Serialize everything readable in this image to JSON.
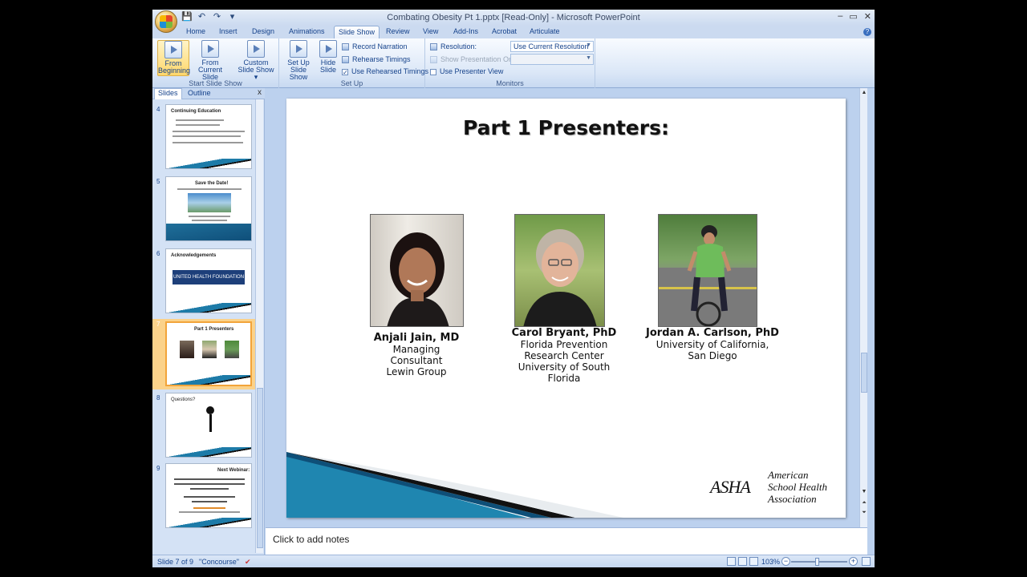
{
  "window": {
    "title": "Combating Obesity Pt 1.pptx [Read-Only] - Microsoft PowerPoint",
    "controls": [
      "–",
      "▭",
      "✕"
    ]
  },
  "qat": [
    "💾",
    "↶",
    "↷",
    "▾"
  ],
  "tabs": [
    {
      "label": "Home"
    },
    {
      "label": "Insert"
    },
    {
      "label": "Design"
    },
    {
      "label": "Animations"
    },
    {
      "label": "Slide Show"
    },
    {
      "label": "Review"
    },
    {
      "label": "View"
    },
    {
      "label": "Add-Ins"
    },
    {
      "label": "Acrobat"
    },
    {
      "label": "Articulate"
    }
  ],
  "help": "?",
  "ribbon": {
    "start": {
      "label": "Start Slide Show",
      "from_beginning": [
        "From",
        "Beginning"
      ],
      "from_current": [
        "From",
        "Current Slide"
      ],
      "custom": [
        "Custom",
        "Slide Show ▾"
      ]
    },
    "setup": {
      "label": "Set Up",
      "setup_btn": [
        "Set Up",
        "Slide Show"
      ],
      "hide_btn": [
        "Hide",
        "Slide"
      ],
      "record": "Record Narration",
      "rehearse": "Rehearse Timings",
      "use_rehearsed": "Use Rehearsed Timings",
      "use_rehearsed_check": "✓"
    },
    "monitors": {
      "label": "Monitors",
      "resolution_label": "Resolution:",
      "resolution_value": "Use Current Resolution",
      "show_on_label": "Show Presentation On:",
      "presenter_view": "Use Presenter View"
    }
  },
  "panel": {
    "tabs": [
      "Slides",
      "Outline"
    ],
    "close": "x",
    "thumbs": [
      {
        "num": "4",
        "title": "Continuing Education"
      },
      {
        "num": "5",
        "title": "Save the Date!"
      },
      {
        "num": "6",
        "title": "Acknowledgements",
        "banner": "UNITED HEALTH FOUNDATION"
      },
      {
        "num": "7",
        "title": "Part 1 Presenters"
      },
      {
        "num": "8",
        "title": "Questions?"
      },
      {
        "num": "9",
        "title": "Next Webinar:"
      }
    ]
  },
  "slide": {
    "title": "Part 1 Presenters:",
    "presenters": [
      {
        "name": "Anjali Jain, MD",
        "lines": [
          "Managing",
          "Consultant",
          "Lewin Group"
        ]
      },
      {
        "name": "Carol Bryant, PhD",
        "lines": [
          "Florida Prevention",
          "Research Center",
          "University of South",
          "Florida"
        ]
      },
      {
        "name": "Jordan A. Carlson, PhD",
        "lines": [
          "University of California,",
          "San Diego"
        ]
      }
    ],
    "logo": {
      "mark": "ASHA",
      "lines": [
        "American",
        "School Health",
        "Association"
      ]
    }
  },
  "notes_placeholder": "Click to add notes",
  "status": {
    "slide_info": "Slide 7 of 9",
    "theme": "\"Concourse\"",
    "zoom": "103%",
    "zoom_minus": "−",
    "zoom_plus": "+"
  }
}
